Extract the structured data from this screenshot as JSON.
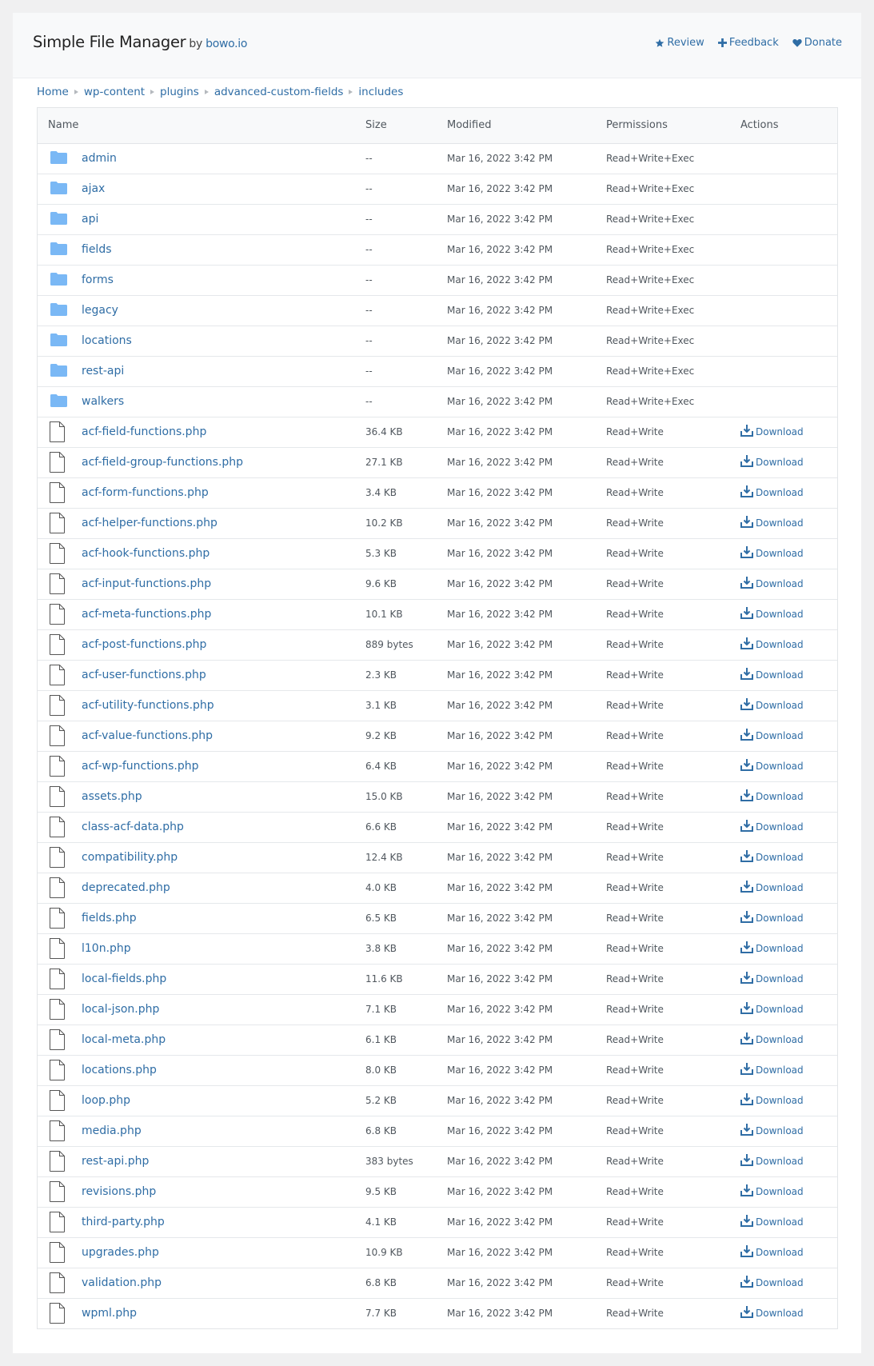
{
  "header": {
    "title": "Simple File Manager",
    "by_label": "by",
    "author_link": "bowo.io",
    "links": [
      {
        "icon": "star-icon",
        "label": "Review"
      },
      {
        "icon": "plus-icon",
        "label": "Feedback"
      },
      {
        "icon": "heart-icon",
        "label": "Donate"
      }
    ]
  },
  "breadcrumb": [
    "Home",
    "wp-content",
    "plugins",
    "advanced-custom-fields",
    "includes"
  ],
  "table": {
    "columns": [
      "Name",
      "Size",
      "Modified",
      "Permissions",
      "Actions"
    ],
    "download_label": "Download",
    "rows": [
      {
        "type": "folder",
        "name": "admin",
        "size": "--",
        "modified": "Mar 16, 2022 3:42 PM",
        "permissions": "Read+Write+Exec"
      },
      {
        "type": "folder",
        "name": "ajax",
        "size": "--",
        "modified": "Mar 16, 2022 3:42 PM",
        "permissions": "Read+Write+Exec"
      },
      {
        "type": "folder",
        "name": "api",
        "size": "--",
        "modified": "Mar 16, 2022 3:42 PM",
        "permissions": "Read+Write+Exec"
      },
      {
        "type": "folder",
        "name": "fields",
        "size": "--",
        "modified": "Mar 16, 2022 3:42 PM",
        "permissions": "Read+Write+Exec"
      },
      {
        "type": "folder",
        "name": "forms",
        "size": "--",
        "modified": "Mar 16, 2022 3:42 PM",
        "permissions": "Read+Write+Exec"
      },
      {
        "type": "folder",
        "name": "legacy",
        "size": "--",
        "modified": "Mar 16, 2022 3:42 PM",
        "permissions": "Read+Write+Exec"
      },
      {
        "type": "folder",
        "name": "locations",
        "size": "--",
        "modified": "Mar 16, 2022 3:42 PM",
        "permissions": "Read+Write+Exec"
      },
      {
        "type": "folder",
        "name": "rest-api",
        "size": "--",
        "modified": "Mar 16, 2022 3:42 PM",
        "permissions": "Read+Write+Exec"
      },
      {
        "type": "folder",
        "name": "walkers",
        "size": "--",
        "modified": "Mar 16, 2022 3:42 PM",
        "permissions": "Read+Write+Exec"
      },
      {
        "type": "file",
        "name": "acf-field-functions.php",
        "size": "36.4 KB",
        "modified": "Mar 16, 2022 3:42 PM",
        "permissions": "Read+Write"
      },
      {
        "type": "file",
        "name": "acf-field-group-functions.php",
        "size": "27.1 KB",
        "modified": "Mar 16, 2022 3:42 PM",
        "permissions": "Read+Write"
      },
      {
        "type": "file",
        "name": "acf-form-functions.php",
        "size": "3.4 KB",
        "modified": "Mar 16, 2022 3:42 PM",
        "permissions": "Read+Write"
      },
      {
        "type": "file",
        "name": "acf-helper-functions.php",
        "size": "10.2 KB",
        "modified": "Mar 16, 2022 3:42 PM",
        "permissions": "Read+Write"
      },
      {
        "type": "file",
        "name": "acf-hook-functions.php",
        "size": "5.3 KB",
        "modified": "Mar 16, 2022 3:42 PM",
        "permissions": "Read+Write"
      },
      {
        "type": "file",
        "name": "acf-input-functions.php",
        "size": "9.6 KB",
        "modified": "Mar 16, 2022 3:42 PM",
        "permissions": "Read+Write"
      },
      {
        "type": "file",
        "name": "acf-meta-functions.php",
        "size": "10.1 KB",
        "modified": "Mar 16, 2022 3:42 PM",
        "permissions": "Read+Write"
      },
      {
        "type": "file",
        "name": "acf-post-functions.php",
        "size": "889 bytes",
        "modified": "Mar 16, 2022 3:42 PM",
        "permissions": "Read+Write"
      },
      {
        "type": "file",
        "name": "acf-user-functions.php",
        "size": "2.3 KB",
        "modified": "Mar 16, 2022 3:42 PM",
        "permissions": "Read+Write"
      },
      {
        "type": "file",
        "name": "acf-utility-functions.php",
        "size": "3.1 KB",
        "modified": "Mar 16, 2022 3:42 PM",
        "permissions": "Read+Write"
      },
      {
        "type": "file",
        "name": "acf-value-functions.php",
        "size": "9.2 KB",
        "modified": "Mar 16, 2022 3:42 PM",
        "permissions": "Read+Write"
      },
      {
        "type": "file",
        "name": "acf-wp-functions.php",
        "size": "6.4 KB",
        "modified": "Mar 16, 2022 3:42 PM",
        "permissions": "Read+Write"
      },
      {
        "type": "file",
        "name": "assets.php",
        "size": "15.0 KB",
        "modified": "Mar 16, 2022 3:42 PM",
        "permissions": "Read+Write"
      },
      {
        "type": "file",
        "name": "class-acf-data.php",
        "size": "6.6 KB",
        "modified": "Mar 16, 2022 3:42 PM",
        "permissions": "Read+Write"
      },
      {
        "type": "file",
        "name": "compatibility.php",
        "size": "12.4 KB",
        "modified": "Mar 16, 2022 3:42 PM",
        "permissions": "Read+Write"
      },
      {
        "type": "file",
        "name": "deprecated.php",
        "size": "4.0 KB",
        "modified": "Mar 16, 2022 3:42 PM",
        "permissions": "Read+Write"
      },
      {
        "type": "file",
        "name": "fields.php",
        "size": "6.5 KB",
        "modified": "Mar 16, 2022 3:42 PM",
        "permissions": "Read+Write"
      },
      {
        "type": "file",
        "name": "l10n.php",
        "size": "3.8 KB",
        "modified": "Mar 16, 2022 3:42 PM",
        "permissions": "Read+Write"
      },
      {
        "type": "file",
        "name": "local-fields.php",
        "size": "11.6 KB",
        "modified": "Mar 16, 2022 3:42 PM",
        "permissions": "Read+Write"
      },
      {
        "type": "file",
        "name": "local-json.php",
        "size": "7.1 KB",
        "modified": "Mar 16, 2022 3:42 PM",
        "permissions": "Read+Write"
      },
      {
        "type": "file",
        "name": "local-meta.php",
        "size": "6.1 KB",
        "modified": "Mar 16, 2022 3:42 PM",
        "permissions": "Read+Write"
      },
      {
        "type": "file",
        "name": "locations.php",
        "size": "8.0 KB",
        "modified": "Mar 16, 2022 3:42 PM",
        "permissions": "Read+Write"
      },
      {
        "type": "file",
        "name": "loop.php",
        "size": "5.2 KB",
        "modified": "Mar 16, 2022 3:42 PM",
        "permissions": "Read+Write"
      },
      {
        "type": "file",
        "name": "media.php",
        "size": "6.8 KB",
        "modified": "Mar 16, 2022 3:42 PM",
        "permissions": "Read+Write"
      },
      {
        "type": "file",
        "name": "rest-api.php",
        "size": "383 bytes",
        "modified": "Mar 16, 2022 3:42 PM",
        "permissions": "Read+Write"
      },
      {
        "type": "file",
        "name": "revisions.php",
        "size": "9.5 KB",
        "modified": "Mar 16, 2022 3:42 PM",
        "permissions": "Read+Write"
      },
      {
        "type": "file",
        "name": "third-party.php",
        "size": "4.1 KB",
        "modified": "Mar 16, 2022 3:42 PM",
        "permissions": "Read+Write"
      },
      {
        "type": "file",
        "name": "upgrades.php",
        "size": "10.9 KB",
        "modified": "Mar 16, 2022 3:42 PM",
        "permissions": "Read+Write"
      },
      {
        "type": "file",
        "name": "validation.php",
        "size": "6.8 KB",
        "modified": "Mar 16, 2022 3:42 PM",
        "permissions": "Read+Write"
      },
      {
        "type": "file",
        "name": "wpml.php",
        "size": "7.7 KB",
        "modified": "Mar 16, 2022 3:42 PM",
        "permissions": "Read+Write"
      }
    ]
  },
  "colors": {
    "link": "#2f6da5",
    "folder_icon": "#7ab8f5",
    "page_bg": "#f0f0f1",
    "header_bg": "#f8f9fa"
  }
}
